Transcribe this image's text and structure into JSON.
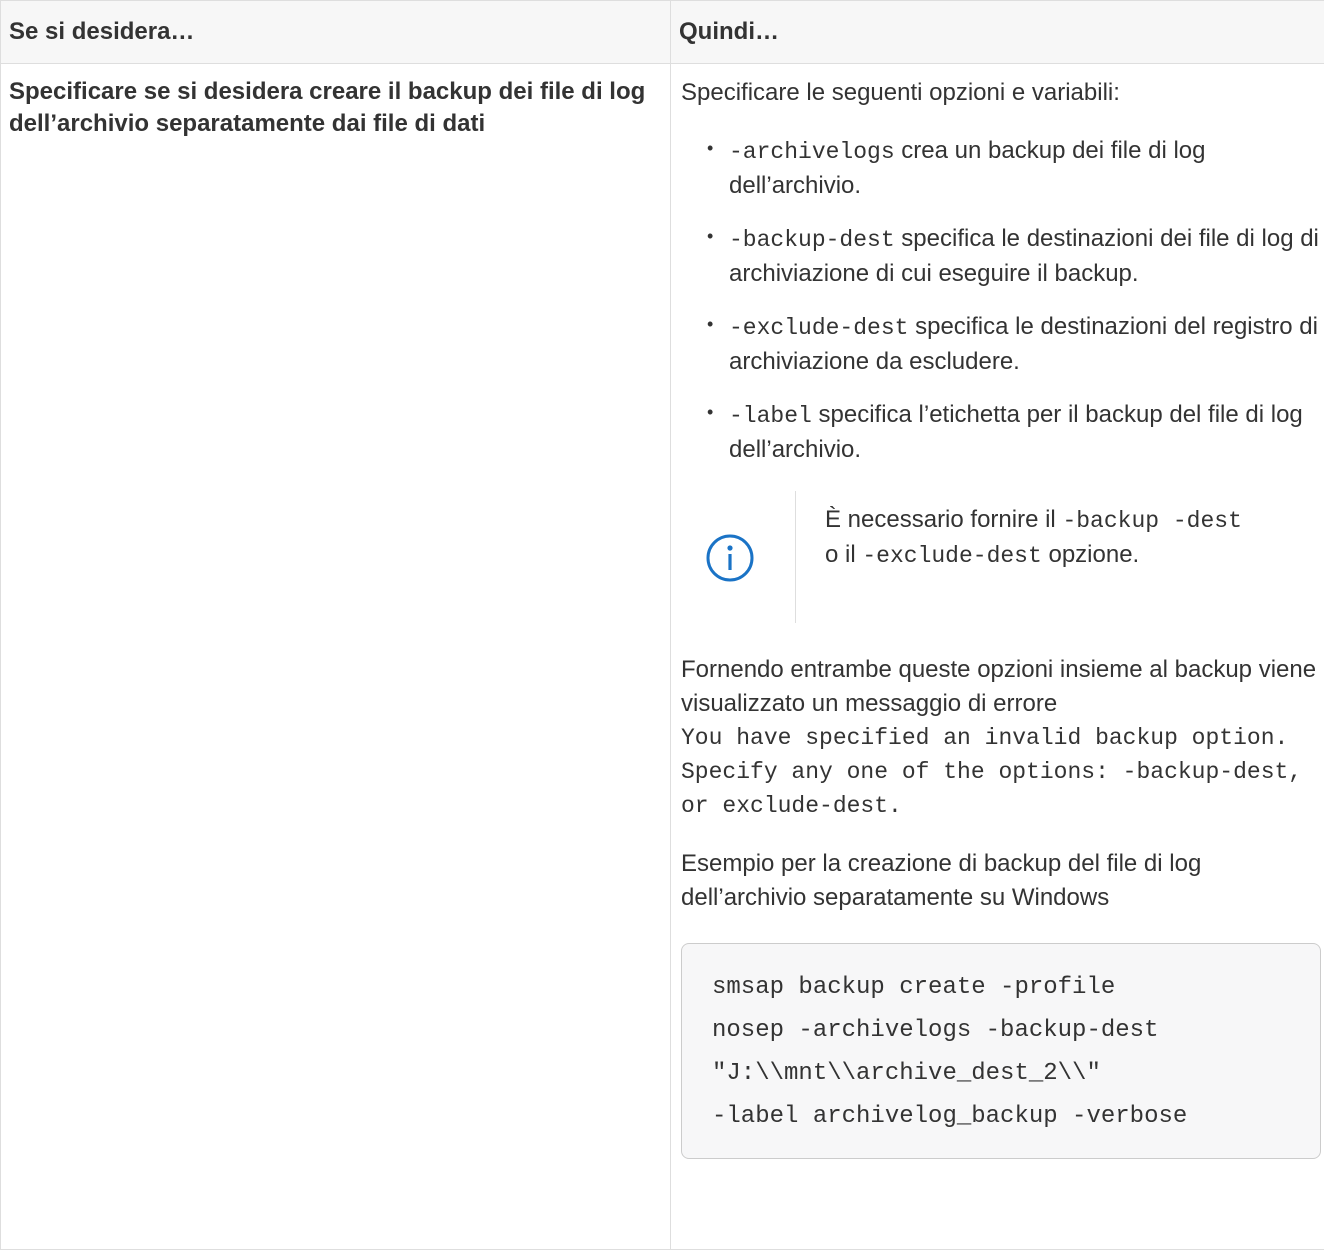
{
  "table": {
    "header": {
      "col1": "Se si desidera…",
      "col2": "Quindi…"
    },
    "row": {
      "condition": "Specificare se si desidera creare il backup dei file di log dell’archivio separatamente dai file di dati",
      "intro": "Specificare le seguenti opzioni e variabili:",
      "options": [
        {
          "flag": "-archivelogs",
          "desc": " crea un backup dei file di log dell’archivio."
        },
        {
          "flag": "-backup-dest",
          "desc": " specifica le destinazioni dei file di log di archiviazione di cui eseguire il backup."
        },
        {
          "flag": "-exclude-dest",
          "desc": " specifica le destinazioni del registro di archiviazione da escludere."
        },
        {
          "flag": "-label",
          "desc": " specifica l’etichetta per il backup del file di log dell’archivio."
        }
      ],
      "note": {
        "icon": "info-icon",
        "text_start": "È necessario fornire il ",
        "flag1": "-backup -dest",
        "text_mid": " o il ",
        "flag2": "-exclude-dest",
        "text_end": " opzione."
      },
      "error_para": "Fornendo entrambe queste opzioni insieme al backup viene visualizzato un messaggio di errore",
      "error_message": "You have specified an invalid backup option. Specify any one of the options: -backup-dest, or exclude-dest.",
      "example_caption": "Esempio per la creazione di backup del file di log dell’archivio separatamente su Windows",
      "code": "smsap backup create -profile\nnosep -archivelogs -backup-dest\n\"J:\\\\mnt\\\\archive_dest_2\\\\\"\n-label archivelog_backup -verbose"
    }
  }
}
